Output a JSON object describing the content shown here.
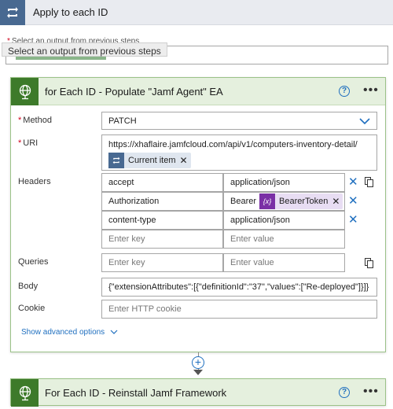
{
  "loop": {
    "title": "Apply to each ID"
  },
  "select_output": {
    "label": "Select an output from previous steps",
    "tooltip": "Select an output from previous steps"
  },
  "action": {
    "title": "for Each ID - Populate \"Jamf Agent\" EA",
    "method_label": "Method",
    "method_value": "PATCH",
    "uri_label": "URI",
    "uri_value": "https://xhaflaire.jamfcloud.com/api/v1/computers-inventory-detail/",
    "uri_token": "Current item",
    "headers_label": "Headers",
    "headers": [
      {
        "key": "accept",
        "value": "application/json"
      },
      {
        "key": "Authorization",
        "value_prefix": "Bearer",
        "value_token": "BearerToken"
      },
      {
        "key": "content-type",
        "value": "application/json"
      }
    ],
    "key_placeholder": "Enter key",
    "value_placeholder": "Enter value",
    "queries_label": "Queries",
    "body_label": "Body",
    "body_value": "{\"extensionAttributes\":[{\"definitionId\":\"37\",\"values\":[\"Re-deployed\"]}]}",
    "cookie_label": "Cookie",
    "cookie_placeholder": "Enter HTTP cookie",
    "advanced_label": "Show advanced options",
    "variable_glyph": "{x}"
  },
  "next_action": {
    "title": "For Each ID - Reinstall Jamf Framework"
  },
  "colors": {
    "loop_icon": "#486991",
    "http_icon": "#3d7a2a",
    "card_header": "#e5f0de",
    "variable_token": "#7a2fa5",
    "link": "#1f6fbf"
  },
  "icons": [
    "loop-icon",
    "globe-icon",
    "help-icon",
    "more-icon",
    "chevron-down-icon",
    "close-icon",
    "delete-icon",
    "plus-icon"
  ]
}
